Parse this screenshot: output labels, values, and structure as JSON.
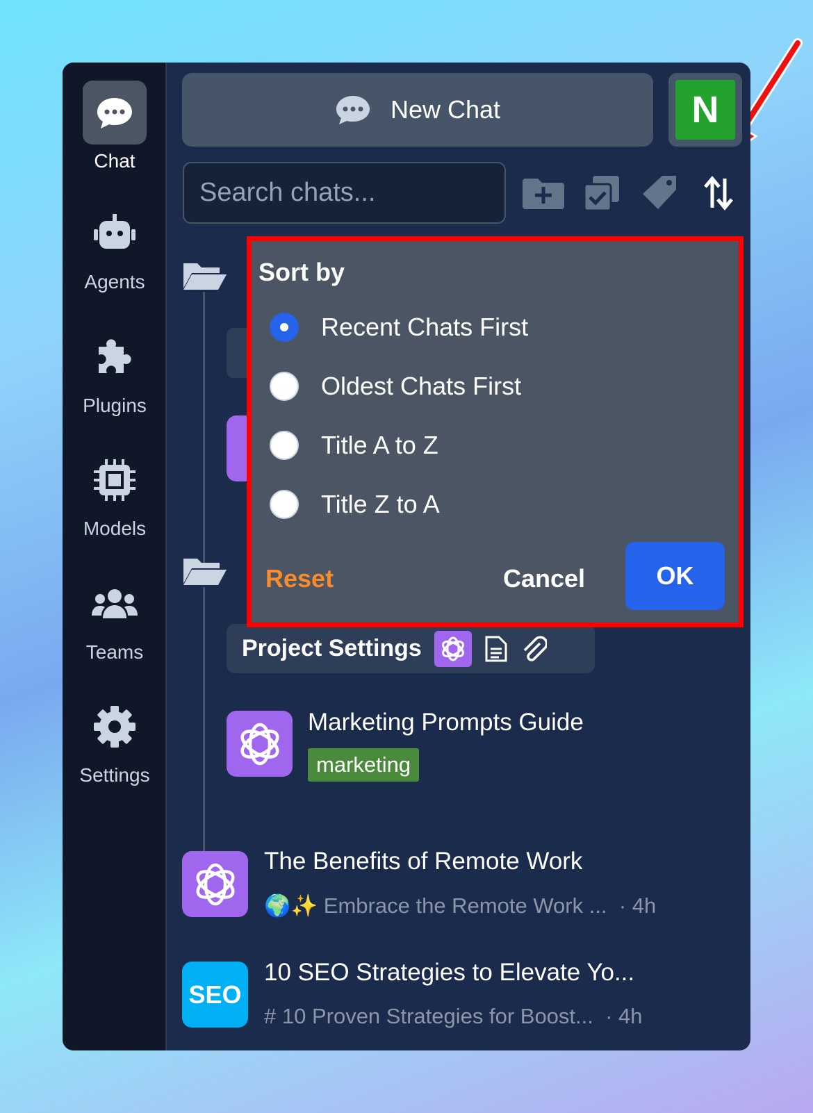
{
  "sidebar": {
    "items": [
      {
        "label": "Chat",
        "icon": "chat-bubble-icon",
        "active": true
      },
      {
        "label": "Agents",
        "icon": "robot-icon"
      },
      {
        "label": "Plugins",
        "icon": "puzzle-icon"
      },
      {
        "label": "Models",
        "icon": "chip-icon"
      },
      {
        "label": "Teams",
        "icon": "users-icon"
      },
      {
        "label": "Settings",
        "icon": "gear-icon"
      }
    ]
  },
  "header": {
    "new_chat": "New Chat",
    "avatar_letter": "N",
    "avatar_color": "#23a32d"
  },
  "search": {
    "placeholder": "Search chats..."
  },
  "toolbar": {
    "icons": [
      "folder-plus-icon",
      "copy-check-icon",
      "tag-icon",
      "sort-icon"
    ]
  },
  "sort_menu": {
    "title": "Sort by",
    "options": [
      "Recent Chats First",
      "Oldest Chats First",
      "Title A to Z",
      "Title Z to A"
    ],
    "selected": "Recent Chats First",
    "reset": "Reset",
    "cancel": "Cancel",
    "ok": "OK"
  },
  "folder": {
    "chip_label": "Project Settings",
    "chat": {
      "title": "Marketing Prompts Guide",
      "tag": "marketing"
    }
  },
  "chats": [
    {
      "title": "The Benefits of Remote Work",
      "preview": "🌍✨ Embrace the Remote Work ...",
      "time": "4h",
      "icon": "openai-icon"
    },
    {
      "title": "10 SEO Strategies to Elevate Yo...",
      "preview": "# 10 Proven Strategies for Boost...",
      "time": "4h",
      "icon": "SEO"
    }
  ],
  "colors": {
    "accent": "#2563eb",
    "reset": "#fb8c2c",
    "highlight": "#ff0000"
  }
}
